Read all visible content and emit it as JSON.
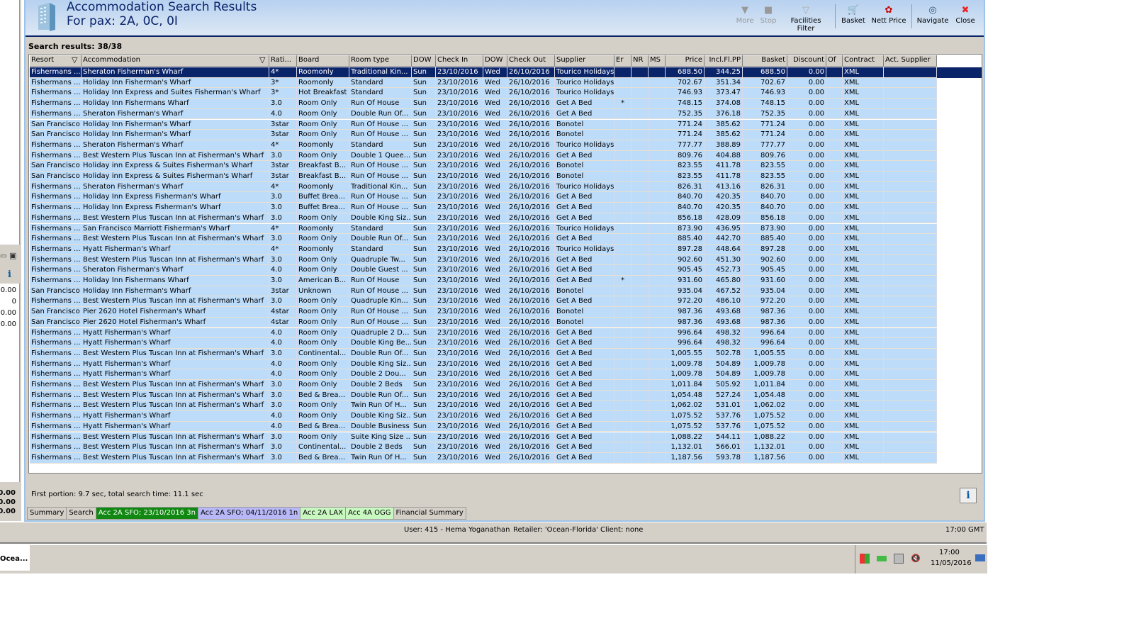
{
  "header": {
    "title": "Accommodation Search Results",
    "subtitle": "For pax: 2A, 0C, 0I"
  },
  "toolbar": [
    {
      "label": "More",
      "icon": "triangle-down-icon",
      "disabled": true
    },
    {
      "label": "Stop",
      "icon": "stop-icon",
      "disabled": true
    },
    {
      "label": "Facilities Filter",
      "icon": "funnel-icon",
      "disabled": false
    },
    {
      "label": "Basket",
      "icon": "cart-icon",
      "disabled": false
    },
    {
      "label": "Nett Price",
      "icon": "price-icon",
      "disabled": false
    },
    {
      "label": "Navigate",
      "icon": "compass-icon",
      "disabled": false
    },
    {
      "label": "Close",
      "icon": "close-icon",
      "disabled": false
    }
  ],
  "search_results": "Search results: 38/38",
  "table": {
    "columns": [
      "Resort",
      "Accommodation",
      "Rati...",
      "Board",
      "Room type",
      "DOW",
      "Check In",
      "DOW",
      "Check Out",
      "Supplier",
      "Er",
      "NR",
      "MS",
      "Price",
      "Incl.Fl.PP",
      "Basket",
      "Discount",
      "Of",
      "Contract",
      "Act. Supplier"
    ],
    "selected_row": 0,
    "rows": [
      [
        "Fishermans ...",
        "Sheraton Fisherman's Wharf",
        "4*",
        "Roomonly",
        "Traditional Kin...",
        "Sun",
        "23/10/2016",
        "Wed",
        "26/10/2016",
        "Tourico Holidays",
        "",
        "",
        "",
        "688.50",
        "344.25",
        "688.50",
        "0.00",
        "",
        "XML",
        ""
      ],
      [
        "Fishermans ...",
        "Holiday Inn Fisherman's Wharf",
        "3*",
        "Roomonly",
        "Standard",
        "Sun",
        "23/10/2016",
        "Wed",
        "26/10/2016",
        "Tourico Holidays",
        "",
        "",
        "",
        "702.67",
        "351.34",
        "702.67",
        "0.00",
        "",
        "XML",
        ""
      ],
      [
        "Fishermans ...",
        "Holiday Inn Express and Suites Fisherman's Wharf",
        "3*",
        "Hot Breakfast",
        "Standard",
        "Sun",
        "23/10/2016",
        "Wed",
        "26/10/2016",
        "Tourico Holidays",
        "",
        "",
        "",
        "746.93",
        "373.47",
        "746.93",
        "0.00",
        "",
        "XML",
        ""
      ],
      [
        "Fishermans ...",
        "Holiday Inn Fishermans Wharf",
        "3.0",
        "Room Only",
        "Run Of House",
        "Sun",
        "23/10/2016",
        "Wed",
        "26/10/2016",
        "Get A Bed",
        "*",
        "",
        "",
        "748.15",
        "374.08",
        "748.15",
        "0.00",
        "",
        "XML",
        ""
      ],
      [
        "Fishermans ...",
        "Sheraton Fisherman's Wharf",
        "4.0",
        "Room Only",
        "Double Run Of...",
        "Sun",
        "23/10/2016",
        "Wed",
        "26/10/2016",
        "Get A Bed",
        "",
        "",
        "",
        "752.35",
        "376.18",
        "752.35",
        "0.00",
        "",
        "XML",
        ""
      ],
      [
        "San Francisco",
        "Holiday Inn Fisherman's Wharf",
        "3star",
        "Room Only",
        "Run Of House ...",
        "Sun",
        "23/10/2016",
        "Wed",
        "26/10/2016",
        "Bonotel",
        "",
        "",
        "",
        "771.24",
        "385.62",
        "771.24",
        "0.00",
        "",
        "XML",
        ""
      ],
      [
        "San Francisco",
        "Holiday Inn Fisherman's Wharf",
        "3star",
        "Room Only",
        "Run Of House ...",
        "Sun",
        "23/10/2016",
        "Wed",
        "26/10/2016",
        "Bonotel",
        "",
        "",
        "",
        "771.24",
        "385.62",
        "771.24",
        "0.00",
        "",
        "XML",
        ""
      ],
      [
        "Fishermans ...",
        "Sheraton Fisherman's Wharf",
        "4*",
        "Roomonly",
        "Standard",
        "Sun",
        "23/10/2016",
        "Wed",
        "26/10/2016",
        "Tourico Holidays",
        "",
        "",
        "",
        "777.77",
        "388.89",
        "777.77",
        "0.00",
        "",
        "XML",
        ""
      ],
      [
        "Fishermans ...",
        "Best Western Plus Tuscan Inn at Fisherman's Wharf",
        "3.0",
        "Room Only",
        "Double 1 Quee...",
        "Sun",
        "23/10/2016",
        "Wed",
        "26/10/2016",
        "Get A Bed",
        "",
        "",
        "",
        "809.76",
        "404.88",
        "809.76",
        "0.00",
        "",
        "XML",
        ""
      ],
      [
        "San Francisco",
        "Holiday inn Express & Suites Fisherman's Wharf",
        "3star",
        "Breakfast B...",
        "Run Of House ...",
        "Sun",
        "23/10/2016",
        "Wed",
        "26/10/2016",
        "Bonotel",
        "",
        "",
        "",
        "823.55",
        "411.78",
        "823.55",
        "0.00",
        "",
        "XML",
        ""
      ],
      [
        "San Francisco",
        "Holiday inn Express & Suites Fisherman's Wharf",
        "3star",
        "Breakfast B...",
        "Run Of House ...",
        "Sun",
        "23/10/2016",
        "Wed",
        "26/10/2016",
        "Bonotel",
        "",
        "",
        "",
        "823.55",
        "411.78",
        "823.55",
        "0.00",
        "",
        "XML",
        ""
      ],
      [
        "Fishermans ...",
        "Sheraton Fisherman's Wharf",
        "4*",
        "Roomonly",
        "Traditional Kin...",
        "Sun",
        "23/10/2016",
        "Wed",
        "26/10/2016",
        "Tourico Holidays",
        "",
        "",
        "",
        "826.31",
        "413.16",
        "826.31",
        "0.00",
        "",
        "XML",
        ""
      ],
      [
        "Fishermans ...",
        "Holiday Inn Express Fisherman's Wharf",
        "3.0",
        "Buffet Brea...",
        "Run Of House ...",
        "Sun",
        "23/10/2016",
        "Wed",
        "26/10/2016",
        "Get A Bed",
        "",
        "",
        "",
        "840.70",
        "420.35",
        "840.70",
        "0.00",
        "",
        "XML",
        ""
      ],
      [
        "Fishermans ...",
        "Holiday Inn Express Fisherman's Wharf",
        "3.0",
        "Buffet Brea...",
        "Run Of House ...",
        "Sun",
        "23/10/2016",
        "Wed",
        "26/10/2016",
        "Get A Bed",
        "",
        "",
        "",
        "840.70",
        "420.35",
        "840.70",
        "0.00",
        "",
        "XML",
        ""
      ],
      [
        "Fishermans ...",
        "Best Western Plus Tuscan Inn at Fisherman's Wharf",
        "3.0",
        "Room Only",
        "Double King Siz...",
        "Sun",
        "23/10/2016",
        "Wed",
        "26/10/2016",
        "Get A Bed",
        "",
        "",
        "",
        "856.18",
        "428.09",
        "856.18",
        "0.00",
        "",
        "XML",
        ""
      ],
      [
        "Fishermans ...",
        "San Francisco Marriott Fisherman's Wharf",
        "4*",
        "Roomonly",
        "Standard",
        "Sun",
        "23/10/2016",
        "Wed",
        "26/10/2016",
        "Tourico Holidays",
        "",
        "",
        "",
        "873.90",
        "436.95",
        "873.90",
        "0.00",
        "",
        "XML",
        ""
      ],
      [
        "Fishermans ...",
        "Best Western Plus Tuscan Inn at Fisherman's Wharf",
        "3.0",
        "Room Only",
        "Double Run Of...",
        "Sun",
        "23/10/2016",
        "Wed",
        "26/10/2016",
        "Get A Bed",
        "",
        "",
        "",
        "885.40",
        "442.70",
        "885.40",
        "0.00",
        "",
        "XML",
        ""
      ],
      [
        "Fishermans ...",
        "Hyatt Fisherman's Wharf",
        "4*",
        "Roomonly",
        "Standard",
        "Sun",
        "23/10/2016",
        "Wed",
        "26/10/2016",
        "Tourico Holidays",
        "",
        "",
        "",
        "897.28",
        "448.64",
        "897.28",
        "0.00",
        "",
        "XML",
        ""
      ],
      [
        "Fishermans ...",
        "Best Western Plus Tuscan Inn at Fisherman's Wharf",
        "3.0",
        "Room Only",
        "Quadruple Tw...",
        "Sun",
        "23/10/2016",
        "Wed",
        "26/10/2016",
        "Get A Bed",
        "",
        "",
        "",
        "902.60",
        "451.30",
        "902.60",
        "0.00",
        "",
        "XML",
        ""
      ],
      [
        "Fishermans ...",
        "Sheraton Fisherman's Wharf",
        "4.0",
        "Room Only",
        "Double Guest ...",
        "Sun",
        "23/10/2016",
        "Wed",
        "26/10/2016",
        "Get A Bed",
        "",
        "",
        "",
        "905.45",
        "452.73",
        "905.45",
        "0.00",
        "",
        "XML",
        ""
      ],
      [
        "Fishermans ...",
        "Holiday Inn Fishermans Wharf",
        "3.0",
        "American B...",
        "Run Of House",
        "Sun",
        "23/10/2016",
        "Wed",
        "26/10/2016",
        "Get A Bed",
        "*",
        "",
        "",
        "931.60",
        "465.80",
        "931.60",
        "0.00",
        "",
        "XML",
        ""
      ],
      [
        "San Francisco",
        "Holiday Inn Fisherman's Wharf",
        "3star",
        "Unknown",
        "Run Of House ...",
        "Sun",
        "23/10/2016",
        "Wed",
        "26/10/2016",
        "Bonotel",
        "",
        "",
        "",
        "935.04",
        "467.52",
        "935.04",
        "0.00",
        "",
        "XML",
        ""
      ],
      [
        "Fishermans ...",
        "Best Western Plus Tuscan Inn at Fisherman's Wharf",
        "3.0",
        "Room Only",
        "Quadruple Kin...",
        "Sun",
        "23/10/2016",
        "Wed",
        "26/10/2016",
        "Get A Bed",
        "",
        "",
        "",
        "972.20",
        "486.10",
        "972.20",
        "0.00",
        "",
        "XML",
        ""
      ],
      [
        "San Francisco",
        "Pier 2620 Hotel Fisherman's Wharf",
        "4star",
        "Room Only",
        "Run Of House ...",
        "Sun",
        "23/10/2016",
        "Wed",
        "26/10/2016",
        "Bonotel",
        "",
        "",
        "",
        "987.36",
        "493.68",
        "987.36",
        "0.00",
        "",
        "XML",
        ""
      ],
      [
        "San Francisco",
        "Pier 2620 Hotel Fisherman's Wharf",
        "4star",
        "Room Only",
        "Run Of House ...",
        "Sun",
        "23/10/2016",
        "Wed",
        "26/10/2016",
        "Bonotel",
        "",
        "",
        "",
        "987.36",
        "493.68",
        "987.36",
        "0.00",
        "",
        "XML",
        ""
      ],
      [
        "Fishermans ...",
        "Hyatt Fisherman's Wharf",
        "4.0",
        "Room Only",
        "Quadruple 2  D...",
        "Sun",
        "23/10/2016",
        "Wed",
        "26/10/2016",
        "Get A Bed",
        "",
        "",
        "",
        "996.64",
        "498.32",
        "996.64",
        "0.00",
        "",
        "XML",
        ""
      ],
      [
        "Fishermans ...",
        "Hyatt Fisherman's Wharf",
        "4.0",
        "Room Only",
        "Double King Be...",
        "Sun",
        "23/10/2016",
        "Wed",
        "26/10/2016",
        "Get A Bed",
        "",
        "",
        "",
        "996.64",
        "498.32",
        "996.64",
        "0.00",
        "",
        "XML",
        ""
      ],
      [
        "Fishermans ...",
        "Best Western Plus Tuscan Inn at Fisherman's Wharf",
        "3.0",
        "Continental...",
        "Double Run Of...",
        "Sun",
        "23/10/2016",
        "Wed",
        "26/10/2016",
        "Get A Bed",
        "",
        "",
        "",
        "1,005.55",
        "502.78",
        "1,005.55",
        "0.00",
        "",
        "XML",
        ""
      ],
      [
        "Fishermans ...",
        "Hyatt Fisherman's Wharf",
        "4.0",
        "Room Only",
        "Double King Siz...",
        "Sun",
        "23/10/2016",
        "Wed",
        "26/10/2016",
        "Get A Bed",
        "",
        "",
        "",
        "1,009.78",
        "504.89",
        "1,009.78",
        "0.00",
        "",
        "XML",
        ""
      ],
      [
        "Fishermans ...",
        "Hyatt Fisherman's Wharf",
        "4.0",
        "Room Only",
        "Double 2  Dou...",
        "Sun",
        "23/10/2016",
        "Wed",
        "26/10/2016",
        "Get A Bed",
        "",
        "",
        "",
        "1,009.78",
        "504.89",
        "1,009.78",
        "0.00",
        "",
        "XML",
        ""
      ],
      [
        "Fishermans ...",
        "Best Western Plus Tuscan Inn at Fisherman's Wharf",
        "3.0",
        "Room Only",
        "Double 2 Beds",
        "Sun",
        "23/10/2016",
        "Wed",
        "26/10/2016",
        "Get A Bed",
        "",
        "",
        "",
        "1,011.84",
        "505.92",
        "1,011.84",
        "0.00",
        "",
        "XML",
        ""
      ],
      [
        "Fishermans ...",
        "Best Western Plus Tuscan Inn at Fisherman's Wharf",
        "3.0",
        "Bed & Brea...",
        "Double Run Of...",
        "Sun",
        "23/10/2016",
        "Wed",
        "26/10/2016",
        "Get A Bed",
        "",
        "",
        "",
        "1,054.48",
        "527.24",
        "1,054.48",
        "0.00",
        "",
        "XML",
        ""
      ],
      [
        "Fishermans ...",
        "Best Western Plus Tuscan Inn at Fisherman's Wharf",
        "3.0",
        "Room Only",
        "Twin Run Of H...",
        "Sun",
        "23/10/2016",
        "Wed",
        "26/10/2016",
        "Get A Bed",
        "",
        "",
        "",
        "1,062.02",
        "531.01",
        "1,062.02",
        "0.00",
        "",
        "XML",
        ""
      ],
      [
        "Fishermans ...",
        "Hyatt Fisherman's Wharf",
        "4.0",
        "Room Only",
        "Double King Siz...",
        "Sun",
        "23/10/2016",
        "Wed",
        "26/10/2016",
        "Get A Bed",
        "",
        "",
        "",
        "1,075.52",
        "537.76",
        "1,075.52",
        "0.00",
        "",
        "XML",
        ""
      ],
      [
        "Fishermans ...",
        "Hyatt Fisherman's Wharf",
        "4.0",
        "Bed & Brea...",
        "Double Business",
        "Sun",
        "23/10/2016",
        "Wed",
        "26/10/2016",
        "Get A Bed",
        "",
        "",
        "",
        "1,075.52",
        "537.76",
        "1,075.52",
        "0.00",
        "",
        "XML",
        ""
      ],
      [
        "Fishermans ...",
        "Best Western Plus Tuscan Inn at Fisherman's Wharf",
        "3.0",
        "Room Only",
        "Suite King Size ...",
        "Sun",
        "23/10/2016",
        "Wed",
        "26/10/2016",
        "Get A Bed",
        "",
        "",
        "",
        "1,088.22",
        "544.11",
        "1,088.22",
        "0.00",
        "",
        "XML",
        ""
      ],
      [
        "Fishermans ...",
        "Best Western Plus Tuscan Inn at Fisherman's Wharf",
        "3.0",
        "Continental...",
        "Double 2 Beds",
        "Sun",
        "23/10/2016",
        "Wed",
        "26/10/2016",
        "Get A Bed",
        "",
        "",
        "",
        "1,132.01",
        "566.01",
        "1,132.01",
        "0.00",
        "",
        "XML",
        ""
      ],
      [
        "Fishermans ...",
        "Best Western Plus Tuscan Inn at Fisherman's Wharf",
        "3.0",
        "Bed & Brea...",
        "Twin Run Of H...",
        "Sun",
        "23/10/2016",
        "Wed",
        "26/10/2016",
        "Get A Bed",
        "",
        "",
        "",
        "1,187.56",
        "593.78",
        "1,187.56",
        "0.00",
        "",
        "XML",
        ""
      ]
    ]
  },
  "timing": "First portion: 9.7 sec, total search time: 11.1 sec",
  "info_label": "i",
  "tabs": [
    {
      "label": "Summary",
      "color": "#d4d0c8",
      "text": "#000"
    },
    {
      "label": "Search",
      "color": "#d4d0c8",
      "text": "#000"
    },
    {
      "label": "Acc 2A SFO; 23/10/2016 3n",
      "color": "#118811",
      "text": "#fff"
    },
    {
      "label": "Acc 2A SFO; 04/11/2016 1n",
      "color": "#b8b8f8",
      "text": "#000"
    },
    {
      "label": "Acc 2A LAX",
      "color": "#c8f8c0",
      "text": "#000"
    },
    {
      "label": "Acc 4A OGG",
      "color": "#c8f8c0",
      "text": "#000"
    },
    {
      "label": "Financial Summary",
      "color": "#d4d0c8",
      "text": "#000"
    }
  ],
  "statusbar": {
    "user": "User: 415 - Hema Yoganathan",
    "retailer": "Retailer: 'Ocean-Florida'",
    "client": "Client: none",
    "time": "17:00 GMT"
  },
  "left_panel": {
    "info": "i",
    "values": [
      "0.00",
      "0",
      "0.00",
      "0.00"
    ],
    "totals": [
      "0.00",
      "0.00",
      "0.00"
    ]
  },
  "taskbar": {
    "app": "Ocea...",
    "time": "17:00",
    "date": "11/05/2016"
  }
}
